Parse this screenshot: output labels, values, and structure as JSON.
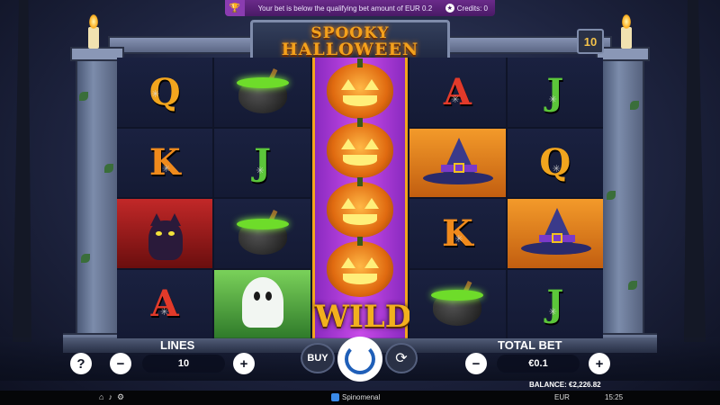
{
  "notice": {
    "message": "Your bet is below the qualifying bet amount of EUR 0.2",
    "credits": "Credits: 0",
    "trophy_icon": "trophy-icon",
    "credits_icon": "star-icon"
  },
  "game": {
    "title_line1": "SPOOKY",
    "title_line2": "HALLOWEEN",
    "lines_badge": "10"
  },
  "reels": [
    [
      "Q",
      "K",
      "black-cat",
      "A"
    ],
    [
      "cauldron",
      "J",
      "cauldron",
      "ghost"
    ],
    [
      "pumpkin",
      "pumpkin",
      "pumpkin",
      "pumpkin"
    ],
    [
      "A",
      "witch-hat",
      "K",
      "cauldron"
    ],
    [
      "J",
      "Q",
      "witch-hat",
      "J"
    ]
  ],
  "wild_label": "WILD",
  "controls": {
    "help": "?",
    "lines_label": "LINES",
    "lines_value": "10",
    "minus": "−",
    "plus": "+",
    "buy_label": "BUY",
    "total_bet_label": "TOTAL BET",
    "total_bet_value": "€0.1"
  },
  "footer": {
    "balance": "BALANCE: €2,226.82",
    "brand": "Spinomenal",
    "currency": "EUR",
    "time": "15:25",
    "icons": [
      "home-icon",
      "sound-icon",
      "settings-icon"
    ]
  },
  "colors": {
    "accent_gold": "#f2a51e",
    "wild_purple": "#c84ae8",
    "notice_purple": "#6a2a8a",
    "spin_blue": "#1f5fb8"
  }
}
